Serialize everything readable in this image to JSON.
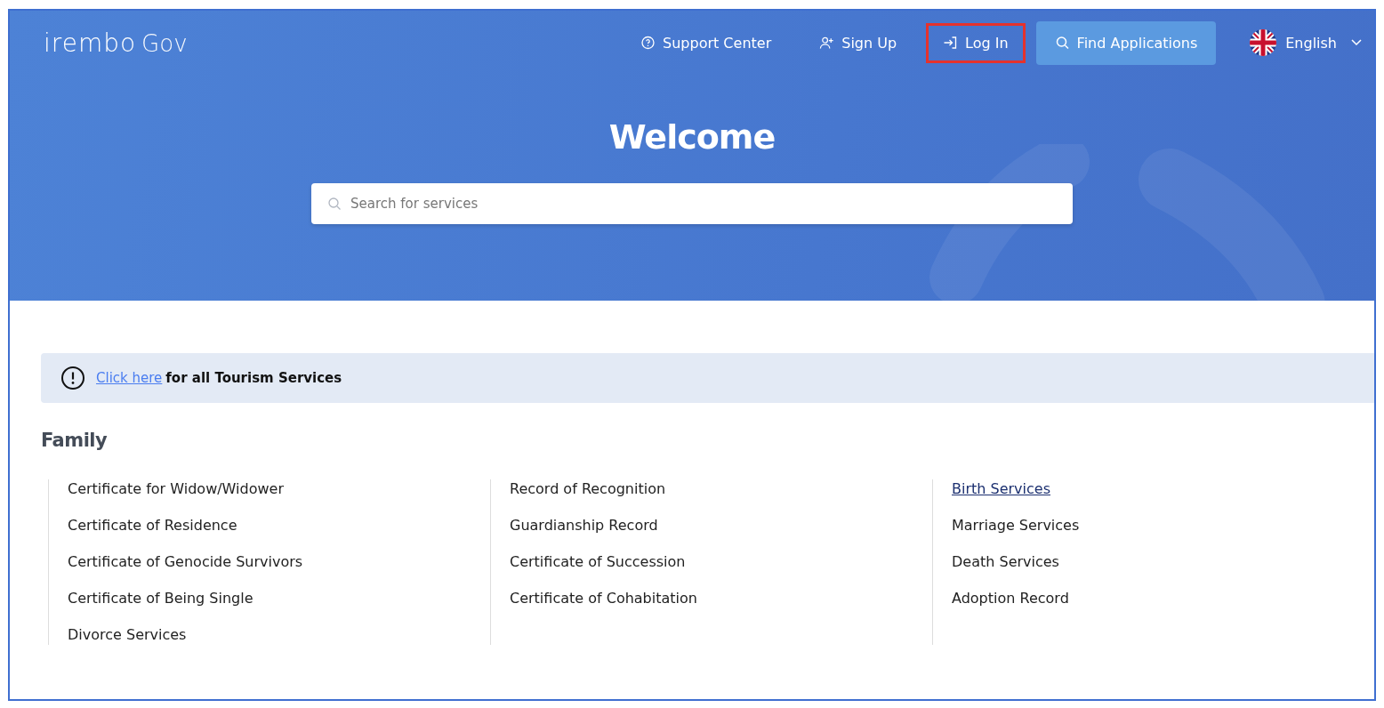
{
  "header": {
    "logo": {
      "brand": "irembo",
      "suffix": "Gov"
    },
    "nav": [
      {
        "kind": "support",
        "label": "Support Center",
        "highlighted": false
      },
      {
        "kind": "signup",
        "label": "Sign Up",
        "highlighted": false
      },
      {
        "kind": "login",
        "label": "Log In",
        "highlighted": true
      },
      {
        "kind": "find",
        "label": "Find Applications",
        "highlighted": false
      }
    ],
    "language": "English",
    "title": "Welcome",
    "search": {
      "placeholder": "Search for services"
    }
  },
  "notice": {
    "link": "Click here",
    "text": "for all Tourism Services"
  },
  "section": {
    "title": "Family",
    "columns": [
      {
        "items": [
          {
            "label": "Certificate for Widow/Widower",
            "hovered": false
          },
          {
            "label": "Certificate of Residence",
            "hovered": false
          },
          {
            "label": "Certificate of Genocide Survivors",
            "hovered": false
          },
          {
            "label": "Certificate of Being Single",
            "hovered": false
          },
          {
            "label": "Divorce Services",
            "hovered": false
          }
        ]
      },
      {
        "items": [
          {
            "label": "Record of Recognition",
            "hovered": false
          },
          {
            "label": "Guardianship Record",
            "hovered": false
          },
          {
            "label": "Certificate of Succession",
            "hovered": false
          },
          {
            "label": "Certificate of Cohabitation",
            "hovered": false
          }
        ]
      },
      {
        "items": [
          {
            "label": "Birth Services",
            "hovered": true
          },
          {
            "label": "Marriage Services",
            "hovered": false
          },
          {
            "label": "Death Services",
            "hovered": false
          },
          {
            "label": "Adoption Record",
            "hovered": false
          }
        ]
      }
    ]
  }
}
